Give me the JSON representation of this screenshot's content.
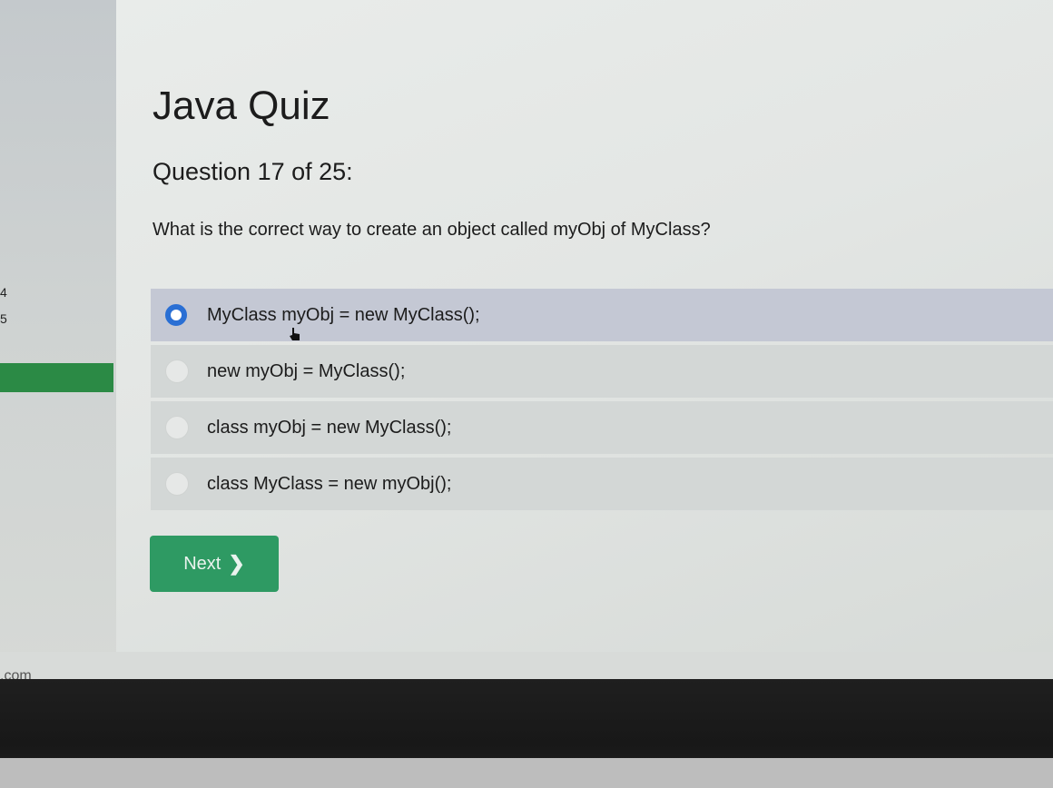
{
  "sidebar": {
    "numbers": [
      "4",
      "5"
    ]
  },
  "quiz": {
    "title": "Java Quiz",
    "progress": "Question 17 of 25:",
    "question": "What is the correct way to create an object called myObj of MyClass?",
    "options": [
      {
        "label": "MyClass myObj = new MyClass();",
        "selected": true
      },
      {
        "label": "new myObj = MyClass();",
        "selected": false
      },
      {
        "label": "class myObj = new MyClass();",
        "selected": false
      },
      {
        "label": "class MyClass = new myObj();",
        "selected": false
      }
    ],
    "next_label": "Next",
    "next_icon": "chevron-right-icon"
  },
  "footer": {
    "site_fragment": ".com"
  },
  "colors": {
    "accent_green": "#2e9a63",
    "sidebar_active": "#2b8a45",
    "radio_selected": "#2a6fd4"
  }
}
